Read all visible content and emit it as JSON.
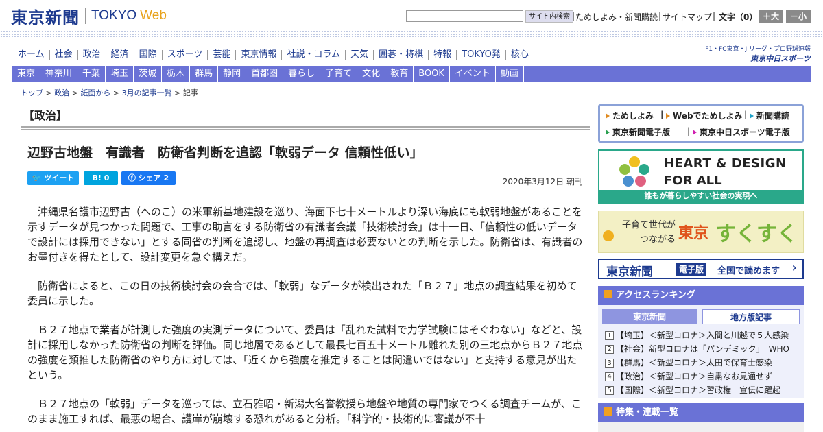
{
  "header": {
    "logo_kanji": "東京新聞",
    "logo_tokyo": "TOKYO",
    "logo_web": "Web",
    "search_button": "サイト内検索",
    "link_trial": "ためしよみ・新聞購読",
    "link_sitemap": "サイトマップ",
    "fontsize_label": "文字（0）",
    "font_bigger": "＋大",
    "font_smaller": "－小"
  },
  "nav_main": [
    "ホーム",
    "社会",
    "政治",
    "経済",
    "国際",
    "スポーツ",
    "芸能",
    "東京情報",
    "社説・コラム",
    "天気",
    "囲碁・将棋",
    "特報",
    "TOKYO発",
    "核心"
  ],
  "chunichi": {
    "top": "F1・FC東京・J リーグ・プロ野球速報",
    "bottom": "東京中日スポーツ"
  },
  "nav_regional": [
    "東京",
    "神奈川",
    "千葉",
    "埼玉",
    "茨城",
    "栃木",
    "群馬",
    "静岡",
    "首都圏",
    "暮らし",
    "子育て",
    "文化",
    "教育",
    "BOOK",
    "イベント",
    "動画"
  ],
  "breadcrumb": {
    "items": [
      "トップ",
      "政治",
      "紙面から",
      "3月の記事一覧",
      "記事"
    ],
    "sep": " > "
  },
  "article": {
    "section": "【政治】",
    "title": "辺野古地盤　有識者　防衛省判断を追認「軟弱データ 信頼性低い」",
    "share_tweet": "ツイート",
    "share_hatena": "B!",
    "share_hatena_count": "0",
    "share_facebook": "シェア",
    "share_facebook_count": "2",
    "date": "2020年3月12日 朝刊",
    "paragraphs": [
      "沖縄県名護市辺野古（へのこ）の米軍新基地建設を巡り、海面下七十メートルより深い海底にも軟弱地盤があることを示すデータが見つかった問題で、工事の助言をする防衛省の有識者会議「技術検討会」は十一日、「信頼性の低いデータで設計には採用できない」とする同省の判断を追認し、地盤の再調査は必要ないとの判断を示した。防衛省は、有識者のお墨付きを得たとして、設計変更を急ぐ構えだ。",
      "防衛省によると、この日の技術検討会の会合では、「軟弱」なデータが検出された「Ｂ２７」地点の調査結果を初めて委員に示した。",
      "Ｂ２７地点で業者が計測した強度の実測データについて、委員は「乱れた試料で力学試験にはそぐわない」などと、設計に採用しなかった防衛省の判断を評価。同じ地層であるとして最長七百五十メートル離れた別の三地点からＢ２７地点の強度を類推した防衛省のやり方に対しては、「近くから強度を推定することは間違いではない」と支持する意見が出たという。",
      "Ｂ２７地点の「軟弱」データを巡っては、立石雅昭・新潟大名誉教授ら地盤や地質の専門家でつくる調査チームが、このまま施工すれば、最悪の場合、護岸が崩壊する恐れがあると分析。「科学的・技術的に審議が不十"
    ]
  },
  "sidebar": {
    "promo_links": [
      "ためしよみ",
      "Webでためしよみ",
      "新聞購読",
      "東京新聞電子版",
      "東京中日スポーツ電子版"
    ],
    "heart_line1": "HEART & DESIGN",
    "heart_line2": "FOR ALL",
    "heart_bar": "誰もが暮らしやすい社会の実現へ",
    "sukusuku_line1": "子育て世代が",
    "sukusuku_line2": "つながる",
    "sukusuku_tokyo": "東京",
    "sukusuku_main": "すくすく",
    "denshi_logo": "東京新聞",
    "denshi_tag": "電子版",
    "denshi_text": "全国で読めます",
    "ranking_title": "アクセスランキング",
    "ranking_tab1": "東京新聞",
    "ranking_tab2": "地方版記事",
    "ranking_items": [
      "【埼玉】＜新型コロナ＞入間と川越で５人感染",
      "【社会】新型コロナは「パンデミック」　WHO",
      "【群馬】＜新型コロナ＞太田で保育士感染",
      "【政治】＜新型コロナ＞自粛なお見通せず",
      "【国際】＜新型コロナ＞習政権　宣伝に躍起"
    ],
    "features_title": "特集・連載一覧"
  }
}
